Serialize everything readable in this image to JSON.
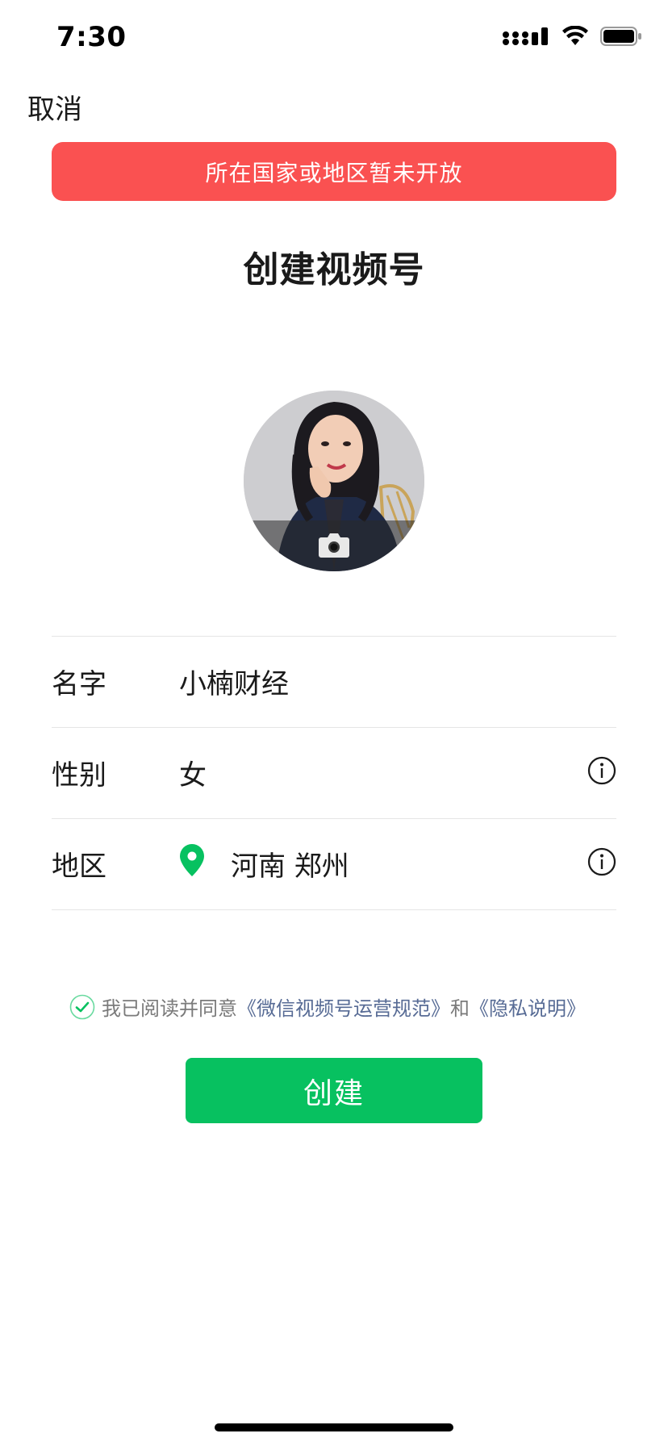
{
  "status_bar": {
    "time": "7:30",
    "icons": [
      "cellular-signal-icon",
      "wifi-icon",
      "battery-icon"
    ]
  },
  "nav": {
    "cancel_label": "取消"
  },
  "banner": {
    "text": "所在国家或地区暂未开放",
    "color": "#fa5151"
  },
  "page": {
    "title": "创建视频号"
  },
  "avatar": {
    "overlay_icon": "camera-icon"
  },
  "form": {
    "name": {
      "label": "名字",
      "value": "小楠财经"
    },
    "gender": {
      "label": "性别",
      "value": "女",
      "icon": "info-icon"
    },
    "region": {
      "label": "地区",
      "value": "河南 郑州",
      "icon": "info-icon",
      "location_icon": "location-pin-icon"
    }
  },
  "agreement": {
    "checked": true,
    "prefix": "我已阅读并同意",
    "link1": "《微信视频号运营规范》",
    "connector": "和",
    "link2": "《隐私说明》"
  },
  "actions": {
    "create_label": "创建"
  },
  "colors": {
    "accent_green": "#07c160",
    "banner_red": "#fa5151",
    "link_blue": "#576b95"
  }
}
